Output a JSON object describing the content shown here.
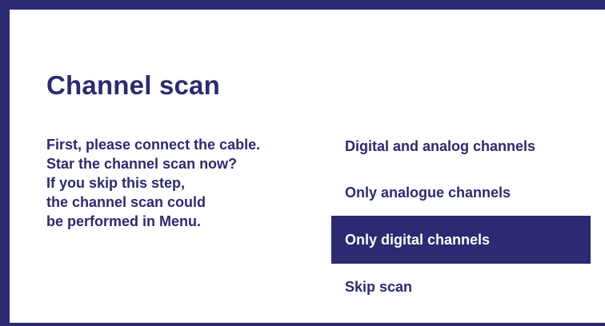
{
  "dialog": {
    "title": "Channel scan",
    "instructions": [
      "First, please connect the cable.",
      "Star the channel scan now?",
      "If you skip this step,",
      "the channel scan could",
      "be performed in Menu."
    ]
  },
  "options": [
    {
      "label": "Digital and analog channels",
      "selected": false
    },
    {
      "label": "Only analogue channels",
      "selected": false
    },
    {
      "label": "Only digital channels",
      "selected": true
    },
    {
      "label": "Skip scan",
      "selected": false
    }
  ],
  "colors": {
    "accent": "#2b2a72",
    "background": "#ffffff",
    "selected_text": "#ffffff"
  }
}
